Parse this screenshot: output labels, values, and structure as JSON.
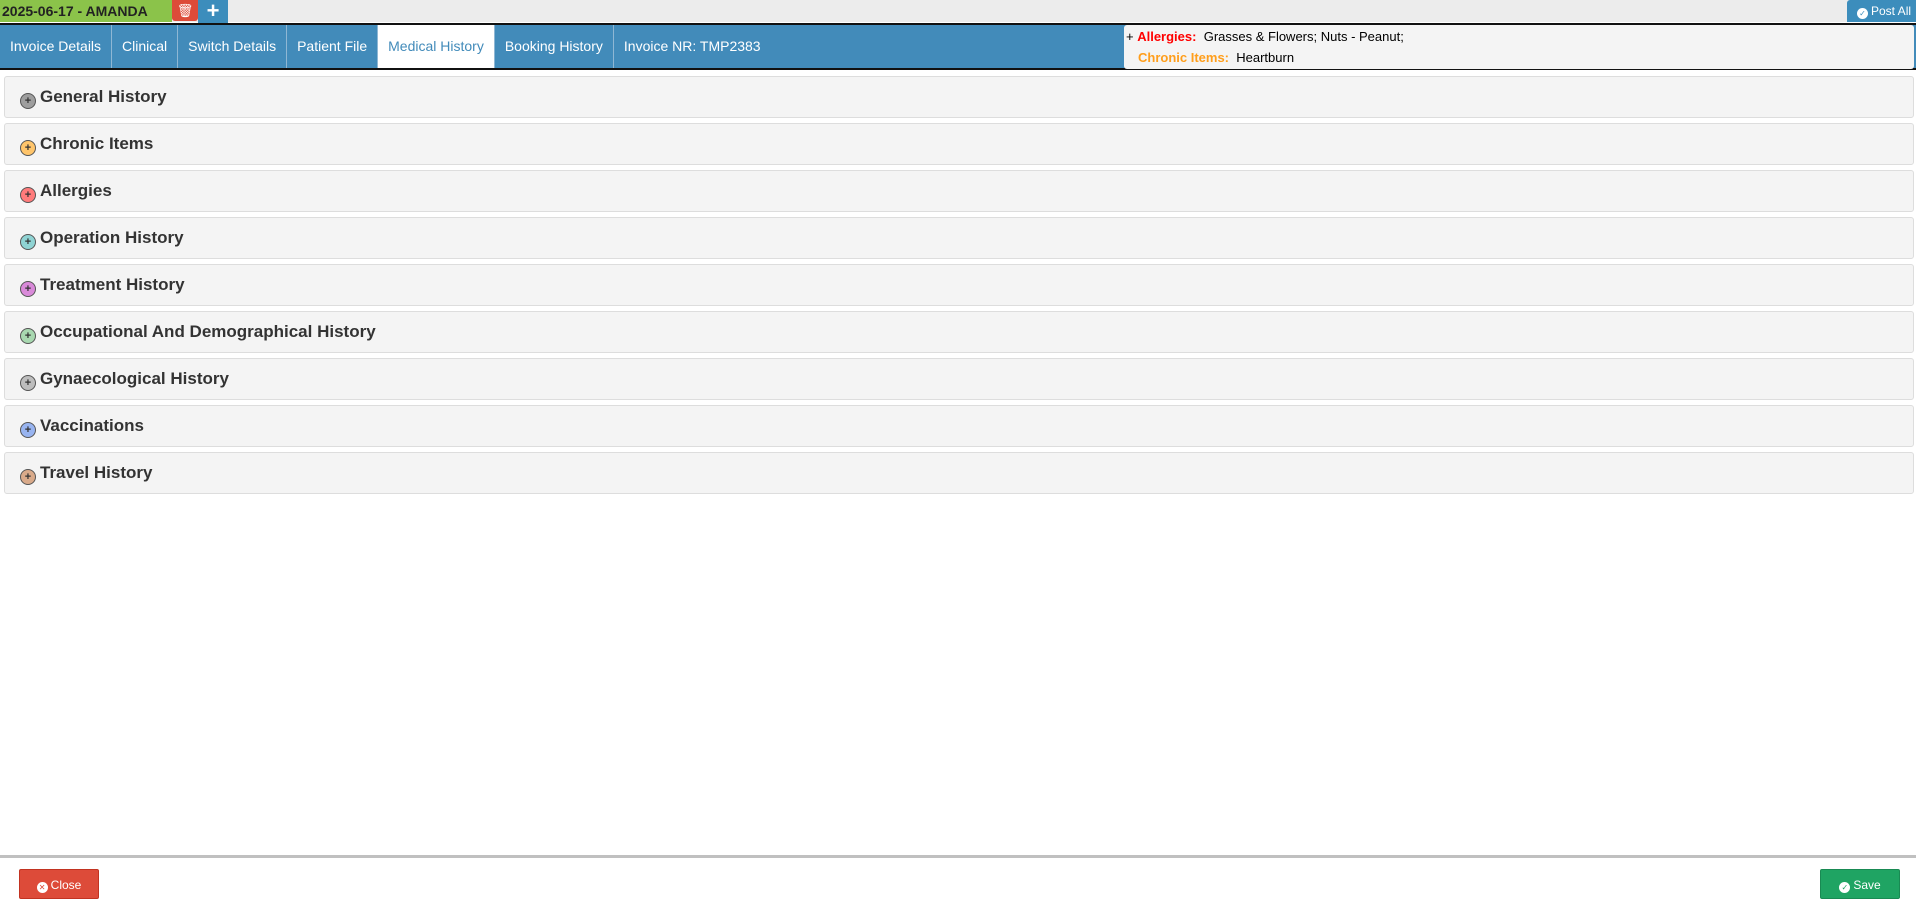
{
  "header": {
    "patient_label": "2025-06-17 - AMANDA",
    "post_all_label": "Post All"
  },
  "tabs": [
    {
      "label": "Invoice Details"
    },
    {
      "label": "Clinical"
    },
    {
      "label": "Switch Details"
    },
    {
      "label": "Patient File"
    },
    {
      "label": "Medical History",
      "active": true
    },
    {
      "label": "Booking History"
    },
    {
      "label": "Invoice NR: TMP2383"
    }
  ],
  "alerts": {
    "toggle": "+",
    "allergies_label": "Allergies:",
    "allergies_value": "Grasses & Flowers; Nuts - Peanut;",
    "chronic_label": "Chronic Items:",
    "chronic_value": "Heartburn",
    "allergies_color": "#ff0000",
    "chronic_color": "#ff9e1b"
  },
  "sections": [
    {
      "title": "General History",
      "color": "#9e9e9e"
    },
    {
      "title": "Chronic Items",
      "color": "#ffc56b"
    },
    {
      "title": "Allergies",
      "color": "#ff7b7b"
    },
    {
      "title": "Operation History",
      "color": "#8fd3d3"
    },
    {
      "title": "Treatment History",
      "color": "#d98ad9"
    },
    {
      "title": "Occupational And Demographical History",
      "color": "#a8d8b0"
    },
    {
      "title": "Gynaecological History",
      "color": "#bdbdbd"
    },
    {
      "title": "Vaccinations",
      "color": "#98b4f0"
    },
    {
      "title": "Travel History",
      "color": "#d9aa8a"
    }
  ],
  "footer": {
    "close_label": "Close",
    "save_label": "Save"
  }
}
